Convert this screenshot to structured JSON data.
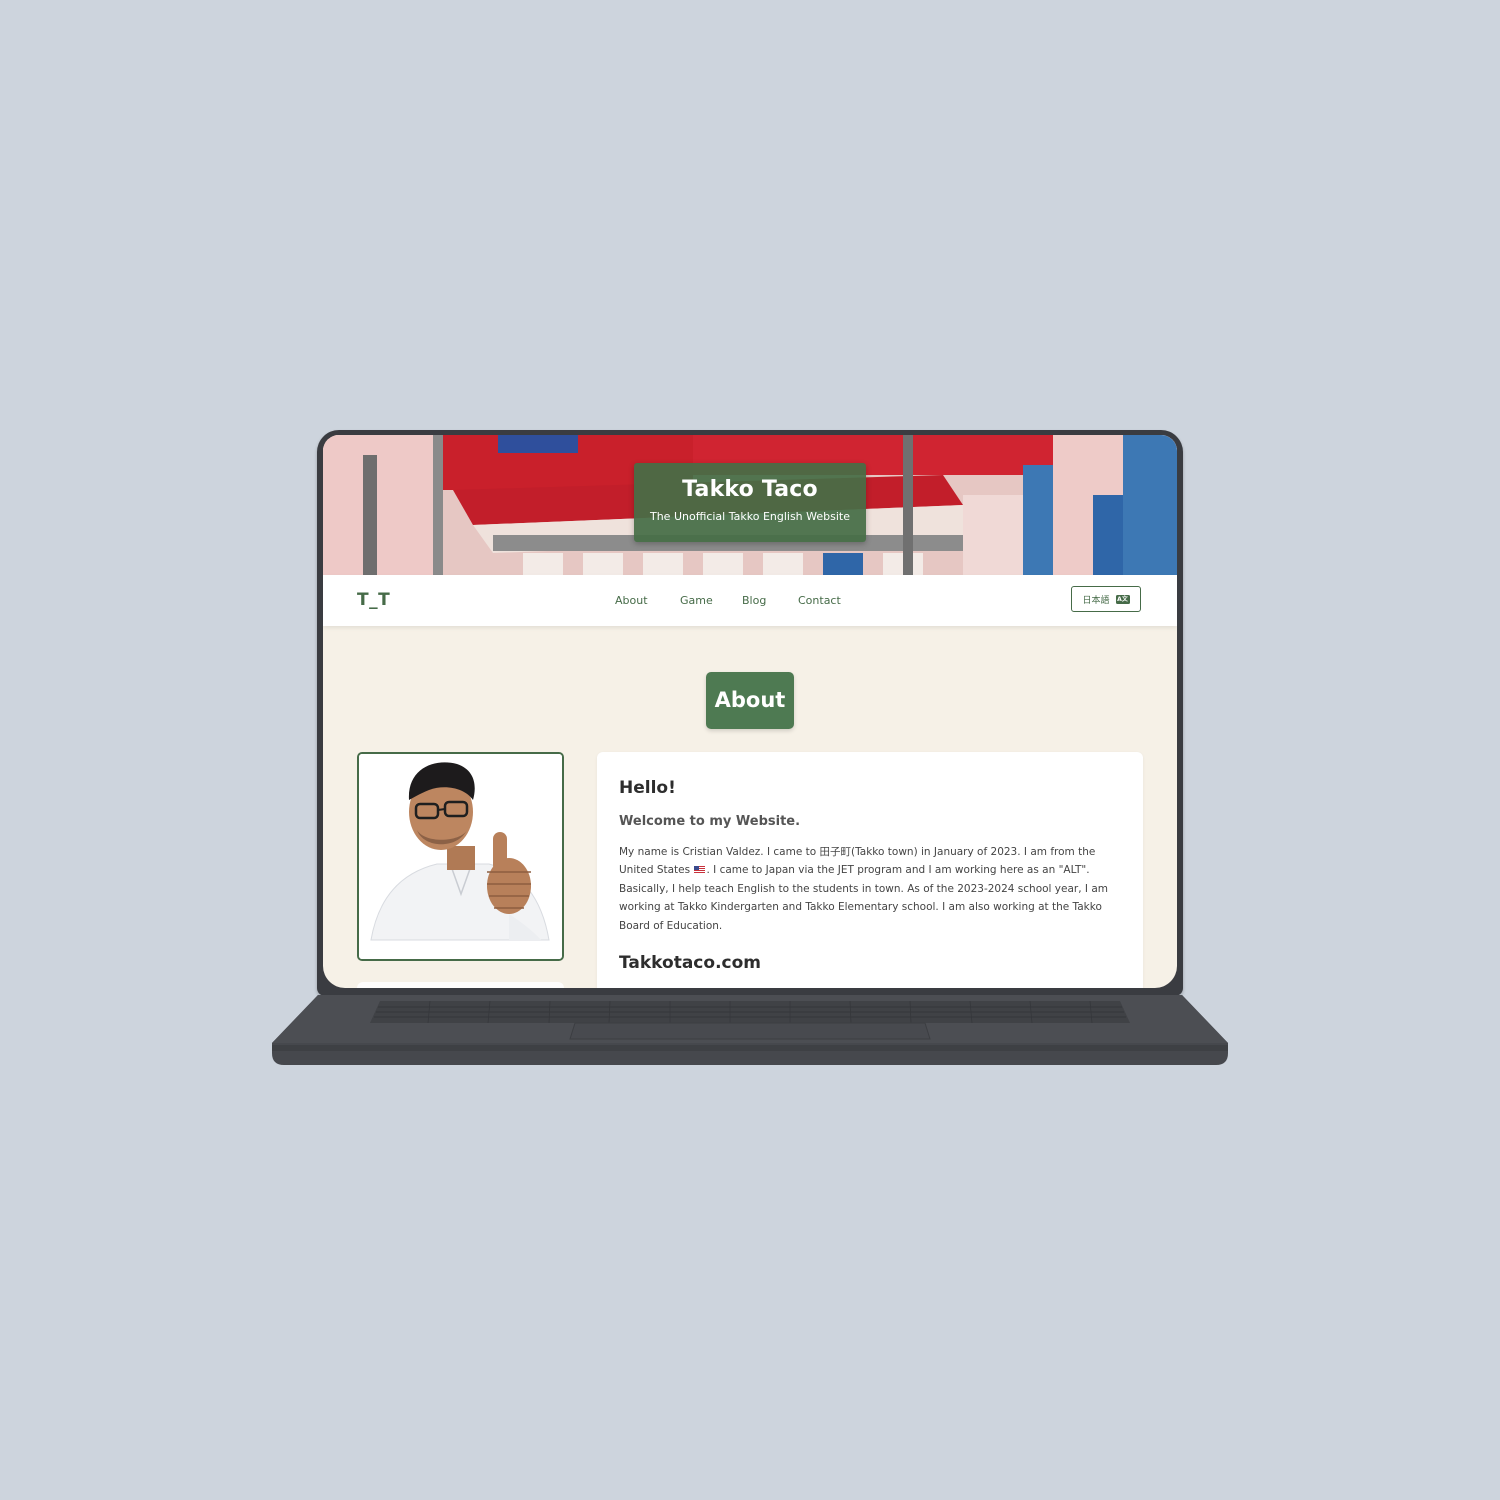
{
  "hero": {
    "title": "Takko Taco",
    "subtitle": "The Unofficial Takko English Website"
  },
  "navbar": {
    "logo": "T_T",
    "items": [
      {
        "label": "About"
      },
      {
        "label": "Game"
      },
      {
        "label": "Blog"
      },
      {
        "label": "Contact"
      }
    ],
    "language_button": {
      "label": "日本語",
      "icon": "translate-icon",
      "icon_text": "A文"
    }
  },
  "page": {
    "heading": "About"
  },
  "profile": {
    "photo_icon": "profile-photo-icon"
  },
  "intro": {
    "hello": "Hello!",
    "welcome": "Welcome to my Website.",
    "bio_part1": "My name is Cristian Valdez. I came to 田子町(Takko town) in January of 2023. I am from the United States",
    "bio_flag": "us-flag-icon",
    "bio_part2": ". I came to Japan via the JET program and I am working here as an \"ALT\". Basically, I help teach English to the students in town. As of the 2023-2024 school year, I am working at Takko Kindergarten and Takko Elementary school. I am also working at the Takko Board of Education.",
    "site_heading": "Takkotaco.com"
  },
  "colors": {
    "brand_green": "#466b48",
    "badge_green": "#4e7a52",
    "background": "#f6f1e7"
  }
}
